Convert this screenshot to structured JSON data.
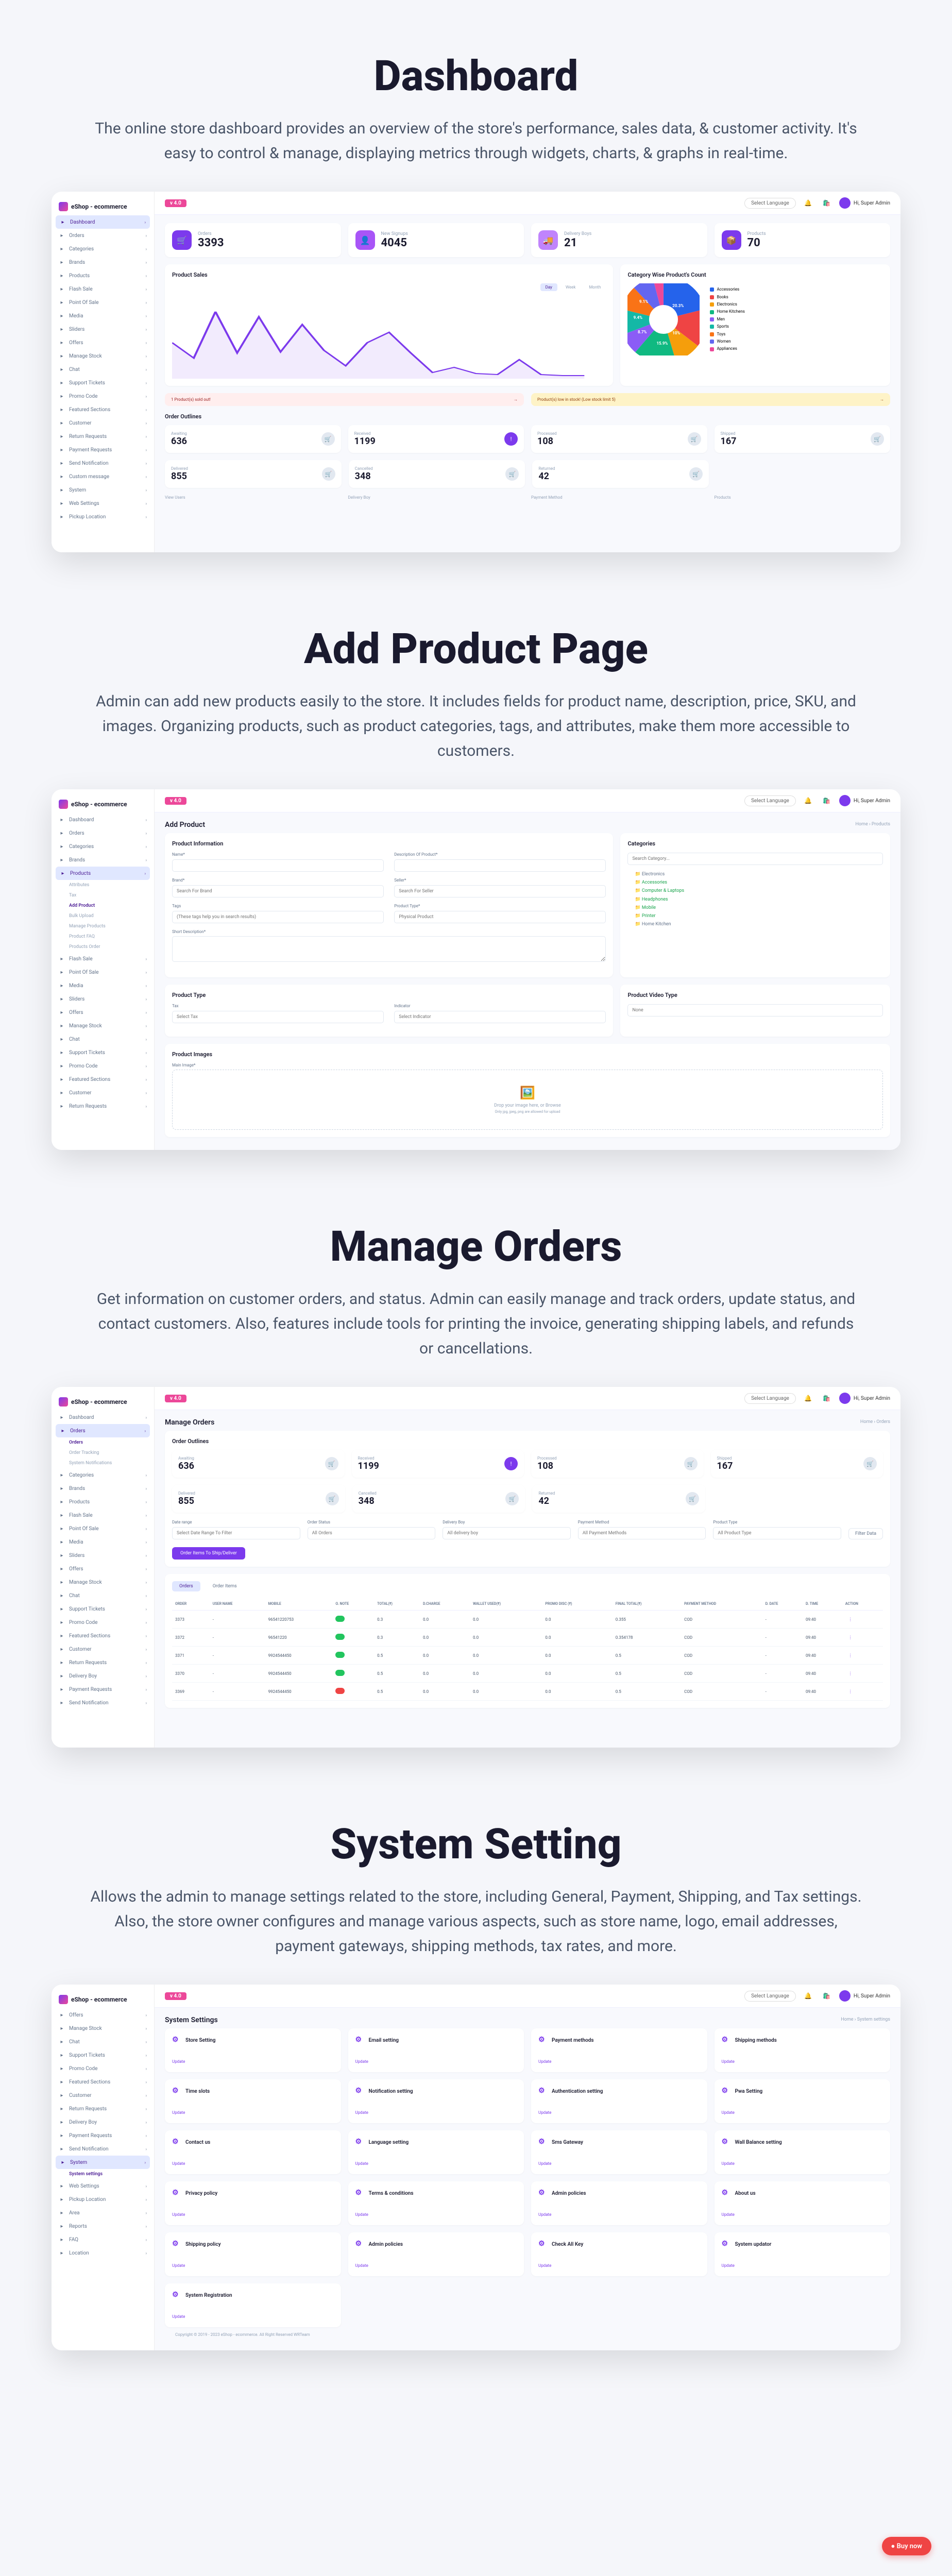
{
  "sections": {
    "dashboard": {
      "title": "Dashboard",
      "desc": "The online store dashboard provides an overview of the store's performance, sales data, & customer activity. It's easy to control & manage, displaying metrics through widgets, charts, & graphs in real-time."
    },
    "addProduct": {
      "title": "Add Product Page",
      "desc": "Admin can add new products easily to the store. It includes fields for product name, description, price, SKU, and images. Organizing products, such as product categories, tags, and attributes, make them more accessible to customers."
    },
    "manageOrders": {
      "title": "Manage Orders",
      "desc": "Get information on customer orders, and status. Admin can easily manage and track orders, update status, and contact customers. Also, features include tools for printing the invoice, generating shipping labels, and refunds or cancellations."
    },
    "systemSetting": {
      "title": "System Setting",
      "desc": "Allows the admin to manage settings related to the store, including General, Payment, Shipping, and Tax settings. Also, the store owner configures and manage various aspects, such as store name, logo, email addresses, payment gateways, shipping methods, tax rates, and more."
    }
  },
  "app": {
    "name": "eShop - ecommerce",
    "newBadge": "v 4.0",
    "langSelect": "Select Language",
    "user": "Hi, Super Admin"
  },
  "sidebar": {
    "dashboard": [
      "Dashboard",
      "Orders",
      "Categories",
      "Brands",
      "Products",
      "Flash Sale",
      "Point Of Sale",
      "Media",
      "Sliders",
      "Offers",
      "Manage Stock",
      "Chat",
      "Support Tickets",
      "Promo Code",
      "Featured Sections",
      "Customer",
      "Return Requests",
      "Payment Requests",
      "Send Notification",
      "Custom message",
      "System",
      "Web Settings",
      "Pickup Location"
    ],
    "addProduct": [
      "Dashboard",
      "Orders",
      "Categories",
      "Brands",
      "Products",
      "Flash Sale",
      "Point Of Sale",
      "Media",
      "Sliders",
      "Offers",
      "Manage Stock",
      "Chat",
      "Support Tickets",
      "Promo Code",
      "Featured Sections",
      "Customer",
      "Return Requests"
    ],
    "productsSub": [
      "Attributes",
      "Tax",
      "Add Product",
      "Bulk Upload",
      "Manage Products",
      "Product FAQ",
      "Products Order"
    ],
    "orders": [
      "Dashboard",
      "Orders",
      "Categories",
      "Brands",
      "Products",
      "Flash Sale",
      "Point Of Sale",
      "Media",
      "Sliders",
      "Offers",
      "Manage Stock",
      "Chat",
      "Support Tickets",
      "Promo Code",
      "Featured Sections",
      "Customer",
      "Return Requests",
      "Delivery Boy",
      "Payment Requests",
      "Send Notification"
    ],
    "ordersSub": [
      "Orders",
      "Order Tracking",
      "System Notifications"
    ],
    "settings": [
      "Offers",
      "Manage Stock",
      "Chat",
      "Support Tickets",
      "Promo Code",
      "Featured Sections",
      "Customer",
      "Return Requests",
      "Delivery Boy",
      "Payment Requests",
      "Send Notification",
      "System",
      "Web Settings",
      "Pickup Location",
      "Area",
      "Reports",
      "FAQ",
      "Location"
    ],
    "settingsSub": [
      "System settings"
    ]
  },
  "dash": {
    "stats": [
      {
        "label": "Orders",
        "value": "3393",
        "color": "#7c3aed",
        "icon": "🛒"
      },
      {
        "label": "New Signups",
        "value": "4045",
        "color": "#a855f7",
        "icon": "👤"
      },
      {
        "label": "Delivery Boys",
        "value": "21",
        "color": "#c084fc",
        "icon": "🚚"
      },
      {
        "label": "Products",
        "value": "70",
        "color": "#7c3aed",
        "icon": "📦"
      }
    ],
    "chartTitle": "Product Sales",
    "chartTabs": [
      "Day",
      "Week",
      "Month"
    ],
    "pieTitle": "Category Wise Product's Count",
    "pieLegend": [
      {
        "label": "Accessories",
        "color": "#2563eb"
      },
      {
        "label": "Books",
        "color": "#ef4444"
      },
      {
        "label": "Electronics",
        "color": "#f59e0b"
      },
      {
        "label": "Home Kitchens",
        "color": "#10b981"
      },
      {
        "label": "Men",
        "color": "#8b5cf6"
      },
      {
        "label": "Sports",
        "color": "#14b8a6"
      },
      {
        "label": "Toys",
        "color": "#f97316"
      },
      {
        "label": "Women",
        "color": "#6366f1"
      },
      {
        "label": "Appliances",
        "color": "#ec4899"
      }
    ],
    "alert1": "1 Product(s) sold out!",
    "alert1btn": "→",
    "alert2": "Product(s) low in stock! (Low stock limit 5)",
    "alert2btn": "→",
    "orderOutlinesTitle": "Order Outlines",
    "orderOutlines1": [
      {
        "label": "Awaiting",
        "value": "636"
      },
      {
        "label": "Received",
        "value": "1199"
      },
      {
        "label": "Processed",
        "value": "108"
      },
      {
        "label": "Shipped",
        "value": "167"
      }
    ],
    "orderOutlines2": [
      {
        "label": "Delivered",
        "value": "855"
      },
      {
        "label": "Cancelled",
        "value": "348"
      },
      {
        "label": "Returned",
        "value": "42"
      }
    ],
    "bottomLinks": [
      "View Users",
      "Delivery Boy",
      "Payment Method",
      "Products"
    ]
  },
  "chart_data": {
    "type": "line",
    "title": "Product Sales",
    "x": [
      1,
      2,
      3,
      4,
      5,
      6,
      7,
      8,
      9,
      10,
      11,
      12,
      13,
      14,
      15,
      16,
      17,
      18,
      19,
      20
    ],
    "values": [
      120,
      60,
      270,
      80,
      230,
      90,
      200,
      100,
      40,
      130,
      180,
      80,
      20,
      40,
      15,
      10,
      60,
      10,
      5,
      5
    ],
    "ylim": [
      0,
      300
    ]
  },
  "addProd": {
    "pageTitle": "Add Product",
    "breadcrumb": "Home › Products",
    "infoTitle": "Product Information",
    "catTitle": "Categories",
    "fields": {
      "name": {
        "label": "Name*",
        "placeholder": ""
      },
      "desc": {
        "label": "Description Of Product*",
        "placeholder": ""
      },
      "brand": {
        "label": "Brand*",
        "placeholder": "Search For Brand"
      },
      "tags": {
        "label": "Tags",
        "placeholder": "(These tags help you in search results)"
      },
      "seller": {
        "label": "Seller*",
        "placeholder": "Search For Seller"
      },
      "prodType": {
        "label": "Product Type*",
        "placeholder": "Physical Product"
      },
      "shortDesc": {
        "label": "Short Description*"
      }
    },
    "catSearch": "Search Category...",
    "catTree": [
      "Electronics",
      "Accessories",
      "Computer & Laptops",
      "Headphones",
      "Mobile",
      "Printer",
      "Home Kitchen"
    ],
    "typeTitle": "Product Type",
    "taxTitle": "Tax",
    "indicatorTitle": "Indicator",
    "videoTitle": "Product Video Type",
    "taxPlaceholder": "Select Tax",
    "indicatorPlaceholder": "Select Indicator",
    "videoPlaceholder": "None",
    "imagesTitle": "Product Images",
    "mainImage": "Main Image*",
    "dropText": "Drop your image here, or Browse",
    "dropSub": "Only jpg, jpeg, png are allowed for upload"
  },
  "orders": {
    "pageTitle": "Manage Orders",
    "breadcrumb": "Home › Orders",
    "outlinesTitle": "Order Outlines",
    "filters": [
      {
        "label": "Date range",
        "placeholder": "Select Date Range To Filter"
      },
      {
        "label": "Order Status",
        "placeholder": "All Orders"
      },
      {
        "label": "Delivery Boy",
        "placeholder": "All delivery boy"
      },
      {
        "label": "Payment Method",
        "placeholder": "All Payment Methods"
      },
      {
        "label": "Product Type",
        "placeholder": "All Product Type"
      }
    ],
    "filterBtn": "Filter Data",
    "createBtn": "Order Items To Ship/Deliver",
    "tabs": [
      "Orders",
      "Order Items"
    ],
    "columns": [
      "ORDER",
      "USER NAME",
      "MOBILE",
      "O. NOTE",
      "TOTAL(₹)",
      "D.CHARGE",
      "WALLET USED(₹)",
      "PROMO DISC (₹)",
      "FINAL TOTAL(₹)",
      "PAYMENT METHOD",
      "D. DATE",
      "D. TIME",
      "ACTION"
    ],
    "rows": [
      {
        "id": "3373",
        "user": "-",
        "mobile": "96541220753",
        "note": true,
        "total": "0.3",
        "dc": "0.0",
        "wu": "0.0",
        "pd": "0.0",
        "ft": "0.355",
        "pm": "COD",
        "dd": "-",
        "dt": "09:40",
        "act": "⋮"
      },
      {
        "id": "3372",
        "user": "-",
        "mobile": "96541220",
        "note": true,
        "total": "0.3",
        "dc": "0.0",
        "wu": "0.0",
        "pd": "0.0",
        "ft": "0.354178",
        "pm": "COD",
        "dd": "-",
        "dt": "09:40",
        "act": "⋮"
      },
      {
        "id": "3371",
        "user": "-",
        "mobile": "9924544450",
        "note": true,
        "total": "0.5",
        "dc": "0.0",
        "wu": "0.0",
        "pd": "0.0",
        "ft": "0.5",
        "pm": "COD",
        "dd": "-",
        "dt": "09:40",
        "act": "⋮"
      },
      {
        "id": "3370",
        "user": "-",
        "mobile": "9924544450",
        "note": true,
        "total": "0.5",
        "dc": "0.0",
        "wu": "0.0",
        "pd": "0.0",
        "ft": "0.5",
        "pm": "COD",
        "dd": "-",
        "dt": "09:40",
        "act": "⋮"
      },
      {
        "id": "3369",
        "user": "-",
        "mobile": "9924544450",
        "note": false,
        "total": "0.5",
        "dc": "0.0",
        "wu": "0.0",
        "pd": "0.0",
        "ft": "0.5",
        "pm": "COD",
        "dd": "-",
        "dt": "09:40",
        "act": "⋮"
      }
    ]
  },
  "settings": {
    "pageTitle": "System Settings",
    "breadcrumb": "Home › System settings",
    "cards": [
      "Store Setting",
      "Email setting",
      "Payment methods",
      "Shipping methods",
      "Time slots",
      "Notification setting",
      "Authentication setting",
      "Pwa Setting",
      "Contact us",
      "Language setting",
      "Sms Gateway",
      "Wall Balance setting",
      "Privacy policy",
      "Terms & conditions",
      "Admin policies",
      "About us",
      "Shipping policy",
      "Admin policies",
      "Check All Key",
      "System updator",
      "System Registration"
    ],
    "updateLink": "Update",
    "footer": "Copyright © 2019 - 2023 eShop - ecommerce. All Right Reserved WRTeam"
  },
  "buyNow": "● Buy now"
}
